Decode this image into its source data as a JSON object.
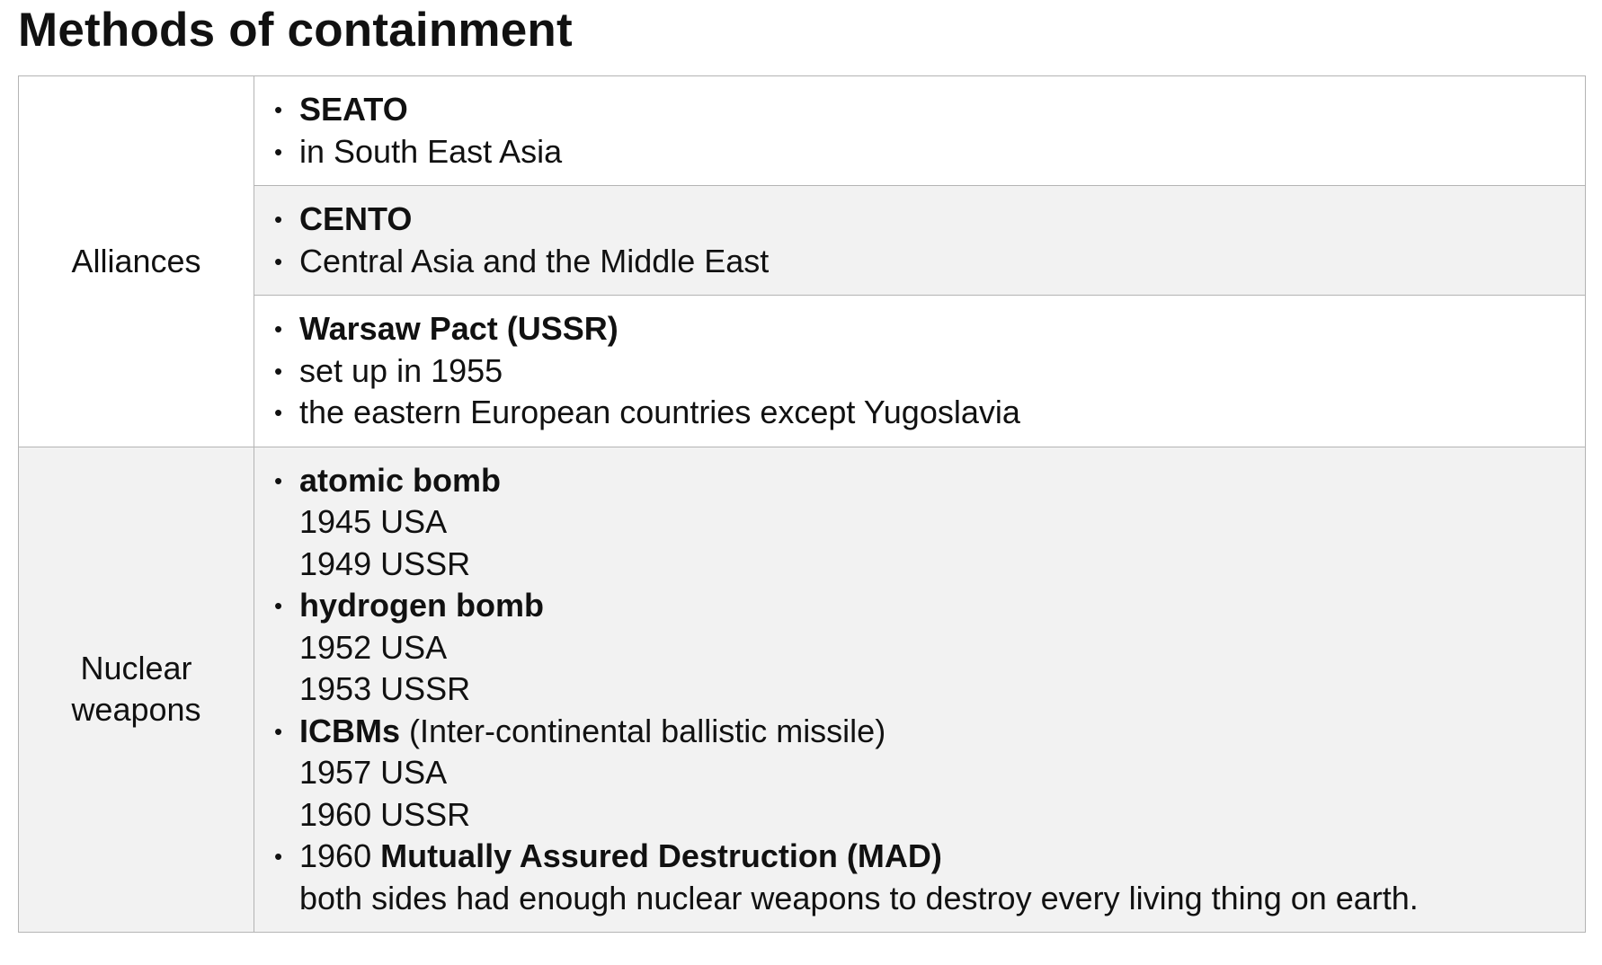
{
  "title": "Methods of containment",
  "alliances": {
    "label": "Alliances",
    "seato": {
      "heading": "SEATO",
      "detail": "in South East Asia"
    },
    "cento": {
      "heading": "CENTO",
      "detail": "Central Asia and the Middle East"
    },
    "warsaw": {
      "heading": "Warsaw Pact (USSR)",
      "detail1": "set up in 1955",
      "detail2": "the eastern European countries except Yugoslavia"
    }
  },
  "nuclear": {
    "label_line1": "Nuclear",
    "label_line2": "weapons",
    "atomic": {
      "heading": "atomic bomb",
      "date1": "1945 USA",
      "date2": "1949 USSR"
    },
    "hydrogen": {
      "heading": "hydrogen bomb",
      "date1": "1952 USA",
      "date2": "1953 USSR"
    },
    "icbm": {
      "heading": "ICBMs",
      "note": " (Inter-continental ballistic missile)",
      "date1": "1957 USA",
      "date2": "1960 USSR"
    },
    "mad": {
      "year": "1960 ",
      "heading": "Mutually Assured Destruction (MAD)",
      "detail": "both sides had enough nuclear weapons to destroy every living thing on earth."
    }
  },
  "bullet_symbol": "•"
}
